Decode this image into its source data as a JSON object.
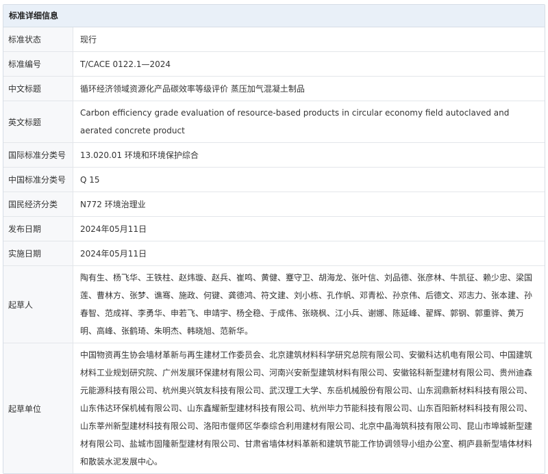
{
  "section_title": "标准详细信息",
  "rows": [
    {
      "label": "标准状态",
      "value": "现行"
    },
    {
      "label": "标准编号",
      "value": "T/CACE 0122.1—2024"
    },
    {
      "label": "中文标题",
      "value": "循环经济领域资源化产品碳效率等级评价 蒸压加气混凝土制品"
    },
    {
      "label": "英文标题",
      "value": "Carbon efficiency grade evaluation of resource-based products in circular economy field autoclaved and aerated concrete product"
    },
    {
      "label": "国际标准分类号",
      "value": "13.020.01 环境和环境保护综合"
    },
    {
      "label": "中国标准分类号",
      "value": "Q 15"
    },
    {
      "label": "国民经济分类",
      "value": "N772 环境治理业"
    },
    {
      "label": "发布日期",
      "value": "2024年05月11日"
    },
    {
      "label": "实施日期",
      "value": "2024年05月11日"
    },
    {
      "label": "起草人",
      "value": "陶有生、杨飞华、王铁柱、赵炜璇、赵兵、崔鸣、黄健、蹇守卫、胡海龙、张叶信、刘品德、张彦林、牛凯征、赖少忠、梁国莲、曹林方、张梦、谯骞、施政、何键、龚德鸿、符文建、刘小栋、孔作帆、邓青松、孙京伟、后德文、邓志力、张本建、孙春智、范成祥、李勇华、申若飞、申靖宇、杨全稳、于成伟、张晓枫、江小兵、谢娜、陈延峰、翟辉、郭钢、郭重骅、黄万明、高峰、张鹤琦、朱明杰、韩晓旭、范新华。"
    },
    {
      "label": "起草单位",
      "value": "中国物资再生协会墙材革新与再生建材工作委员会、北京建筑材料科学研究总院有限公司、安徽科达机电有限公司、中国建筑材料工业规划研究院、广州发展环保建材有限公司、河南兴安新型建筑材料有限公司、安徽铭科新型建材有限公司、贵州迪森元能源科技有限公司、杭州奥兴筑友科技有限公司、武汉理工大学、东岳机械股份有限公司、山东润鼎新材料科技有限公司、山东伟达环保机械有限公司、山东鑫耀新型建材科技有限公司、杭州毕力节能科技有限公司、山东百阳新材料科技有限公司、山东莘州新型建材科技有限公司、洛阳市偃师区华泰综合利用建材有限公司、北京中晶海筑科技有限公司、昆山市埠城新型建材有限公司、盐城市固隆新型建材有限公司、甘肃省墙体材料革新和建筑节能工作协调领导小组办公室、桐庐县新型墙体材料和散装水泥发展中心。"
    }
  ]
}
